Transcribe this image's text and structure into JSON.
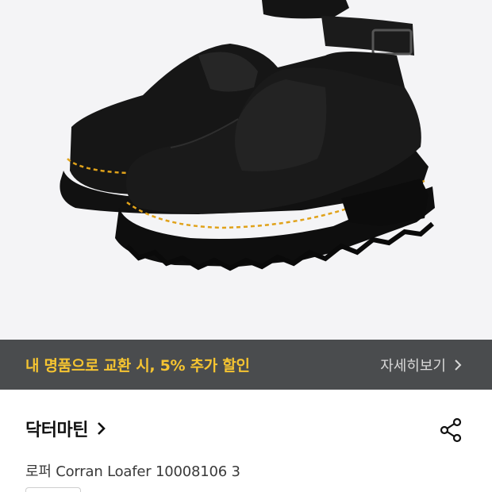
{
  "promo": {
    "text": "내 명품으로 교환 시, 5% 추가 할인",
    "link_label": "자세히보기",
    "link_icon": "chevron-right-icon",
    "text_color": "#f5c431",
    "bar_color": "#4a4c4e"
  },
  "product": {
    "brand": "닥터마틴",
    "brand_icon": "chevron-right-icon",
    "name": "로퍼 Corran Loafer 10008106 3",
    "share_icon": "share-icon"
  },
  "hero": {
    "image": "black-leather-loafers-with-ankle-strap",
    "background": "#f4f4f6"
  }
}
